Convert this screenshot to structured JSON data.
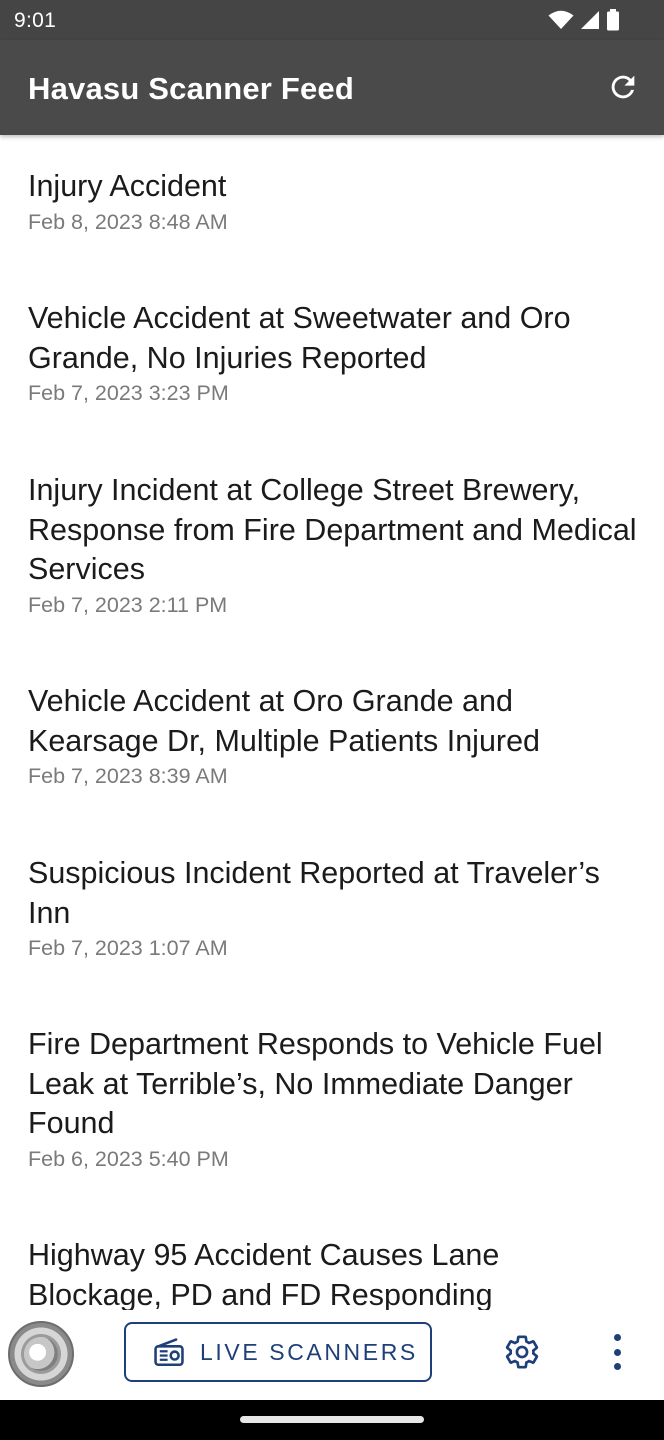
{
  "status_bar": {
    "time": "9:01",
    "icons": [
      "wifi-icon",
      "cell-signal-icon",
      "battery-icon"
    ]
  },
  "app_bar": {
    "title": "Havasu Scanner Feed",
    "actions": [
      "refresh-icon"
    ]
  },
  "feed": {
    "items": [
      {
        "title": "Injury Accident",
        "date": "Feb 8, 2023 8:48 AM"
      },
      {
        "title": "Vehicle Accident at Sweetwater and Oro Grande, No Injuries Reported",
        "date": "Feb 7, 2023 3:23 PM"
      },
      {
        "title": "Injury Incident at College Street Brewery, Response from Fire Department and Medical Services",
        "date": "Feb 7, 2023 2:11 PM"
      },
      {
        "title": "Vehicle Accident at Oro Grande and Kearsage Dr, Multiple Patients Injured",
        "date": "Feb 7, 2023 8:39 AM"
      },
      {
        "title": "Suspicious Incident Reported at Traveler’s Inn",
        "date": "Feb 7, 2023 1:07 AM"
      },
      {
        "title": "Fire Department Responds to Vehicle Fuel Leak at Terrible’s, No Immediate Danger Found",
        "date": "Feb 6, 2023 5:40 PM"
      },
      {
        "title": "Highway 95 Accident Causes Lane Blockage, PD and FD Responding",
        "date": ""
      }
    ]
  },
  "bottom_bar": {
    "live_button_label": "LIVE SCANNERS",
    "icons": [
      "app-logo",
      "radio-icon",
      "gear-icon",
      "more-vert-icon"
    ]
  },
  "colors": {
    "status_bar_bg": "#454545",
    "app_bar_bg": "#4a4a4a",
    "accent": "#1f3f78",
    "title_text": "#1b1b1b",
    "date_text": "#7a7a7a"
  }
}
